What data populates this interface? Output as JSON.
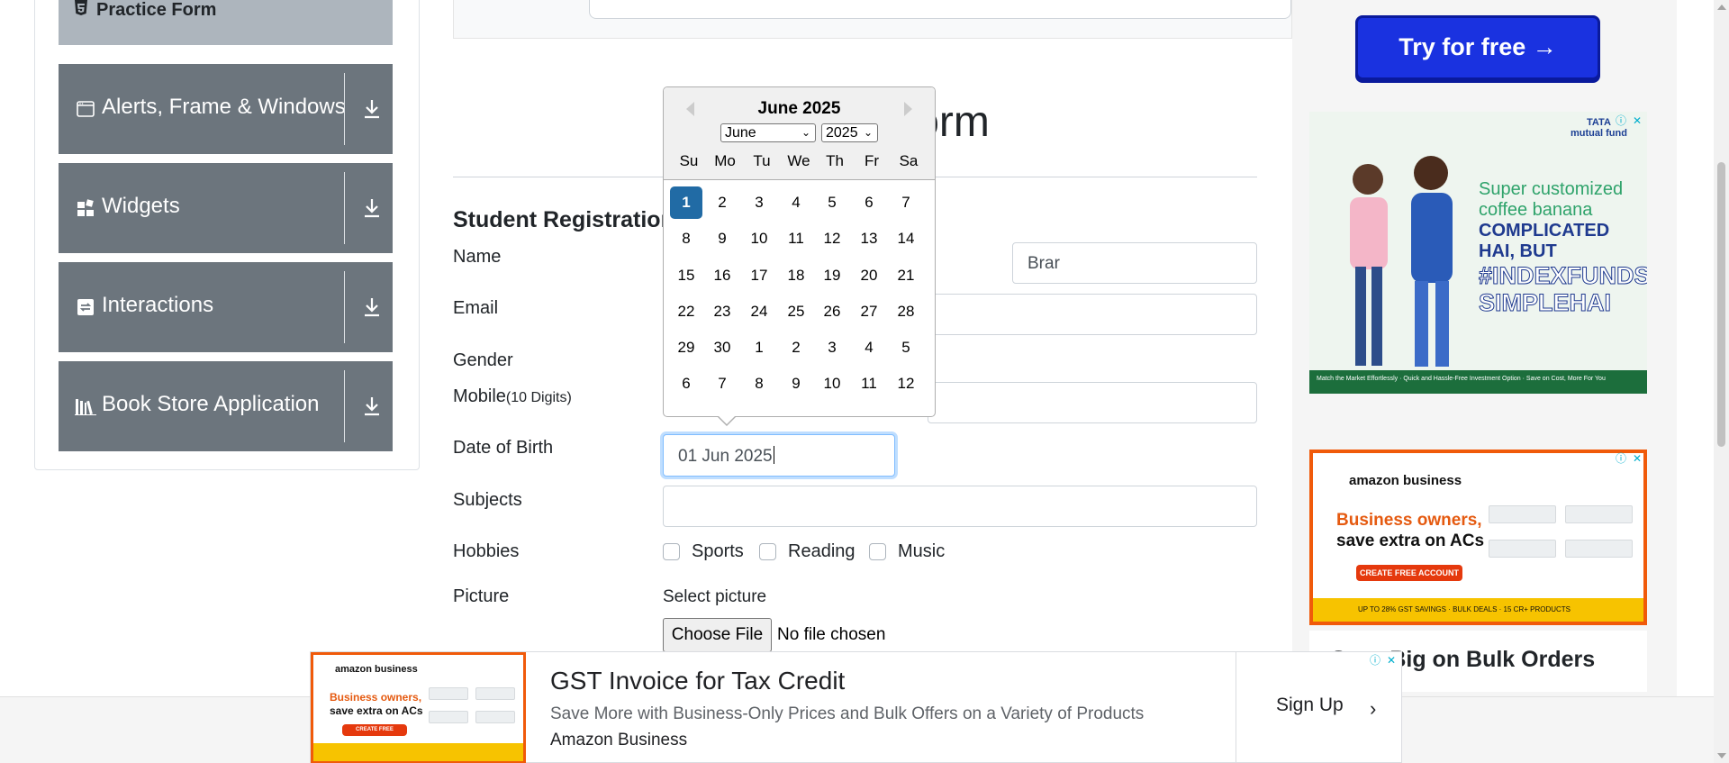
{
  "sidebar": {
    "practice_form": "Practice Form",
    "items": [
      {
        "label": "Alerts, Frame & Windows"
      },
      {
        "label": "Widgets"
      },
      {
        "label": "Interactions"
      },
      {
        "label": "Book Store Application"
      }
    ]
  },
  "main": {
    "heading": "Practice Form",
    "form_title": "Student Registration Form",
    "labels": {
      "name": "Name",
      "email": "Email",
      "gender": "Gender",
      "mobile": "Mobile",
      "mobile_hint": "(10 Digits)",
      "dob": "Date of Birth",
      "subjects": "Subjects",
      "hobbies": "Hobbies",
      "picture": "Picture"
    },
    "last_name_value": "Brar",
    "dob_value": "01 Jun 2025",
    "hobbies": [
      "Sports",
      "Reading",
      "Music"
    ],
    "select_picture": "Select picture",
    "choose_file": "Choose File",
    "no_file": "No file chosen"
  },
  "datepicker": {
    "title": "June 2025",
    "month_value": "June",
    "year_value": "2025",
    "weekdays": [
      "Su",
      "Mo",
      "Tu",
      "We",
      "Th",
      "Fr",
      "Sa"
    ],
    "weeks": [
      [
        "1",
        "2",
        "3",
        "4",
        "5",
        "6",
        "7"
      ],
      [
        "8",
        "9",
        "10",
        "11",
        "12",
        "13",
        "14"
      ],
      [
        "15",
        "16",
        "17",
        "18",
        "19",
        "20",
        "21"
      ],
      [
        "22",
        "23",
        "24",
        "25",
        "26",
        "27",
        "28"
      ],
      [
        "29",
        "30",
        "1",
        "2",
        "3",
        "4",
        "5"
      ],
      [
        "6",
        "7",
        "8",
        "9",
        "10",
        "11",
        "12"
      ]
    ],
    "selected_day": "1"
  },
  "ads": {
    "try_free": "Try for free →",
    "tata": {
      "brand_line1": "TATA",
      "brand_line2": "mutual fund",
      "line1": "Super customized",
      "line2": "coffee banana",
      "line3": "COMPLICATED",
      "line4": "HAI, BUT",
      "line5": "#INDEXFUNDS",
      "line6": "SIMPLEHAI",
      "footer": "Match the Market Effortlessly · Quick and Hassle-Free Investment Option · Save on Cost, More For You"
    },
    "amazon_side": {
      "logo": "amazon business",
      "headline": "Business owners,",
      "subline": "save extra on ACs",
      "cta": "CREATE FREE ACCOUNT",
      "strip": "UP TO 28% GST SAVINGS · BULK DEALS · 15 CR+ PRODUCTS"
    },
    "save_big": "Save Big on Bulk Orders",
    "bottom": {
      "logo": "amazon business",
      "thumb_headline": "Business owners,",
      "thumb_subline": "save extra on ACs",
      "thumb_cta": "CREATE FREE ACCOUNT",
      "headline": "GST Invoice for Tax Credit",
      "description": "Save More with Business-Only Prices and Bulk Offers on a Variety of Products",
      "advertiser": "Amazon Business",
      "cta": "Sign Up"
    }
  },
  "colors": {
    "sidebar_bg": "#6c757d",
    "selected_day": "#216ba5",
    "try_button": "#1a32e0",
    "amazon_orange": "#f05a0a"
  }
}
